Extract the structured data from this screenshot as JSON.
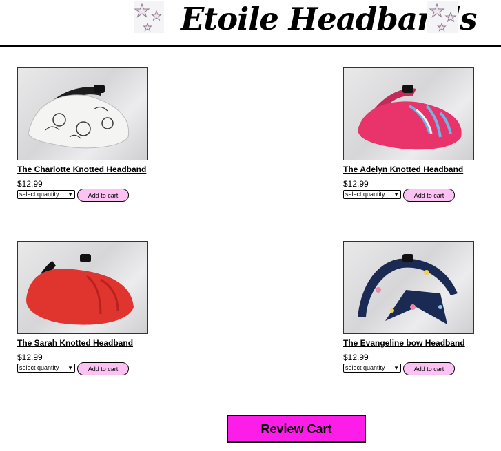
{
  "brand": {
    "title": "Etoile Headbands",
    "left_icon": "stars-icon",
    "right_icon": "stars-icon"
  },
  "products": [
    {
      "name": "The Charlotte Knotted Headband",
      "price": "$12.99",
      "quantity_placeholder": "select quantity",
      "add_label": "Add to cart",
      "image_icon": "floral-white-headband-image",
      "colors": {
        "band": "#f4f4f2",
        "accent": "#3a3a3a"
      }
    },
    {
      "name": "The Adelyn Knotted Headband",
      "price": "$12.99",
      "quantity_placeholder": "select quantity",
      "add_label": "Add to cart",
      "image_icon": "pink-headband-image",
      "colors": {
        "band": "#e8336b",
        "accent": "#6bb7e8"
      }
    },
    {
      "name": "The Sarah Knotted Headband",
      "price": "$12.99",
      "quantity_placeholder": "select quantity",
      "add_label": "Add to cart",
      "image_icon": "red-headband-image",
      "colors": {
        "band": "#e0352f",
        "accent": "#b8211d"
      }
    },
    {
      "name": "The Evangeline bow Headband",
      "price": "$12.99",
      "quantity_placeholder": "select quantity",
      "add_label": "Add to cart",
      "image_icon": "navy-floral-bow-headband-image",
      "colors": {
        "band": "#1b2a52",
        "accent": "#e88aa8"
      }
    }
  ],
  "review_cart_label": "Review Cart",
  "colors": {
    "add_button": "#fbc2f3",
    "review_button": "#fc1ee8"
  }
}
